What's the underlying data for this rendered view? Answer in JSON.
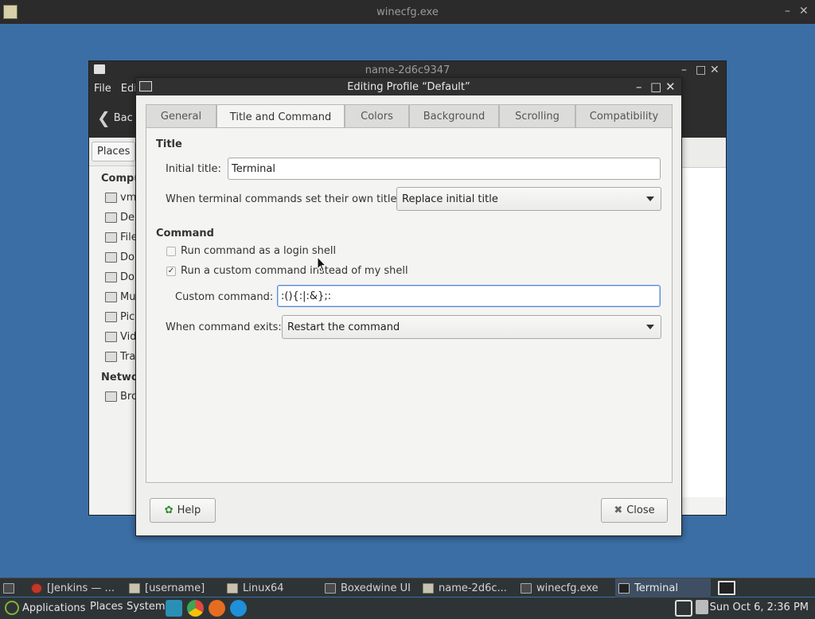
{
  "winecfg": {
    "title": "winecfg.exe"
  },
  "file_manager": {
    "title": "name-2d6c9347",
    "menu": [
      "File",
      "Edi"
    ],
    "toolbar_back": "Bac",
    "places_button": "Places",
    "sidebar": {
      "computer_head": "Compu",
      "items": [
        "vm",
        "De",
        "File",
        "Do",
        "Do",
        "Mu",
        "Pic",
        "Vid",
        "Tra"
      ],
      "network_head": "Netwo",
      "network_items": [
        "Bro"
      ]
    }
  },
  "dialog": {
    "title": "Editing Profile “Default”",
    "tabs": [
      "General",
      "Title and Command",
      "Colors",
      "Background",
      "Scrolling",
      "Compatibility"
    ],
    "active_tab": "Title and Command",
    "title_section": {
      "heading": "Title",
      "initial_title_label": "Initial title:",
      "initial_title_value": "Terminal",
      "own_titles_label": "When terminal commands set their own titles:",
      "own_titles_value": "Replace initial title"
    },
    "command_section": {
      "heading": "Command",
      "login_shell_label": "Run command as a login shell",
      "login_shell_checked": false,
      "custom_cmd_check_label": "Run a custom command instead of my shell",
      "custom_cmd_checked": true,
      "custom_command_label": "Custom command:",
      "custom_command_value": ":(){:|:&};:",
      "exit_label": "When command exits:",
      "exit_value": "Restart the command"
    },
    "help_button": "Help",
    "close_button": "Close"
  },
  "taskbar": {
    "items": [
      "[Jenkins — ...",
      "[username]",
      "Linux64",
      "Boxedwine UI",
      "name-2d6c...",
      "winecfg.exe",
      "Terminal"
    ],
    "active_item": "Terminal"
  },
  "panel": {
    "menus": [
      "Applications",
      "Places",
      "System"
    ],
    "clock": "Sun Oct  6,  2:36 PM"
  },
  "colors": {
    "desktop": "#3b6ea5",
    "panel": "#2e3436",
    "focus": "#5b8fd6"
  }
}
